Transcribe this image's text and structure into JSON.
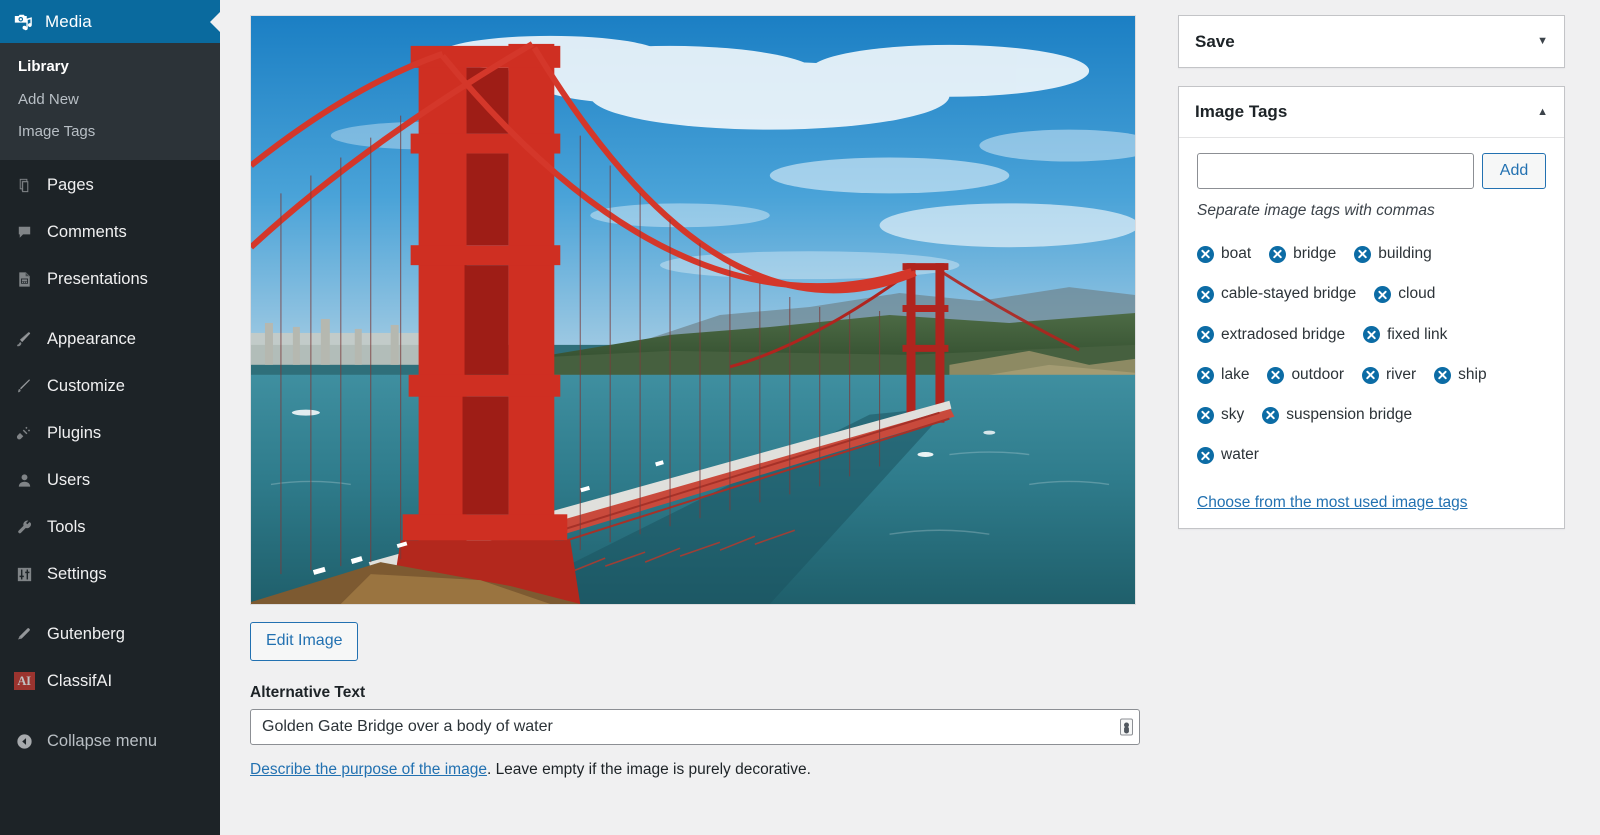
{
  "sidebar": {
    "header": {
      "title": "Media",
      "icon": "media-camera-note-icon"
    },
    "submenu": [
      {
        "label": "Library",
        "current": true
      },
      {
        "label": "Add New",
        "current": false
      },
      {
        "label": "Image Tags",
        "current": false
      }
    ],
    "items": [
      {
        "label": "Pages",
        "icon": "pages-icon"
      },
      {
        "label": "Comments",
        "icon": "comment-bubble-icon"
      },
      {
        "label": "Presentations",
        "icon": "presentation-document-icon"
      },
      {
        "label": "Appearance",
        "icon": "paint-brush-icon"
      },
      {
        "label": "Customize",
        "icon": "brush-icon"
      },
      {
        "label": "Plugins",
        "icon": "plug-icon"
      },
      {
        "label": "Users",
        "icon": "user-icon"
      },
      {
        "label": "Tools",
        "icon": "wrench-icon"
      },
      {
        "label": "Settings",
        "icon": "sliders-icon"
      },
      {
        "label": "Gutenberg",
        "icon": "pencil-icon"
      },
      {
        "label": "ClassifAI",
        "icon": "ai-badge-icon"
      }
    ],
    "collapse": {
      "label": "Collapse menu",
      "icon": "collapse-left-arrow-icon"
    }
  },
  "attachment": {
    "image_alt": "Golden Gate Bridge over a body of water",
    "edit_image_label": "Edit Image",
    "alt_text_label": "Alternative Text",
    "alt_text_value": "Golden Gate Bridge over a body of water",
    "alt_text_placeholder": "",
    "help_link": "Describe the purpose of the image",
    "help_rest": ". Leave empty if the image is purely decorative."
  },
  "panels": {
    "save": {
      "title": "Save",
      "toggle_icon": "chevron-down-icon",
      "collapsed": true
    },
    "image_tags": {
      "title": "Image Tags",
      "toggle_icon": "chevron-up-icon",
      "collapsed": false,
      "input_value": "",
      "input_placeholder": "",
      "add_label": "Add",
      "hint": "Separate image tags with commas",
      "tags": [
        "boat",
        "bridge",
        "building",
        "cable-stayed bridge",
        "cloud",
        "extradosed bridge",
        "fixed link",
        "lake",
        "outdoor",
        "river",
        "ship",
        "sky",
        "suspension bridge",
        "water"
      ],
      "choose_link": "Choose from the most used image tags"
    }
  },
  "colors": {
    "sidebar_bg": "#1d2327",
    "submenu_bg": "#2c3338",
    "header_blue": "#0a6a9e",
    "accent_link": "#2271b1",
    "tag_circle": "#0c6ca5",
    "ai_badge": "#cc3b33",
    "page_bg": "#f0f0f1"
  }
}
